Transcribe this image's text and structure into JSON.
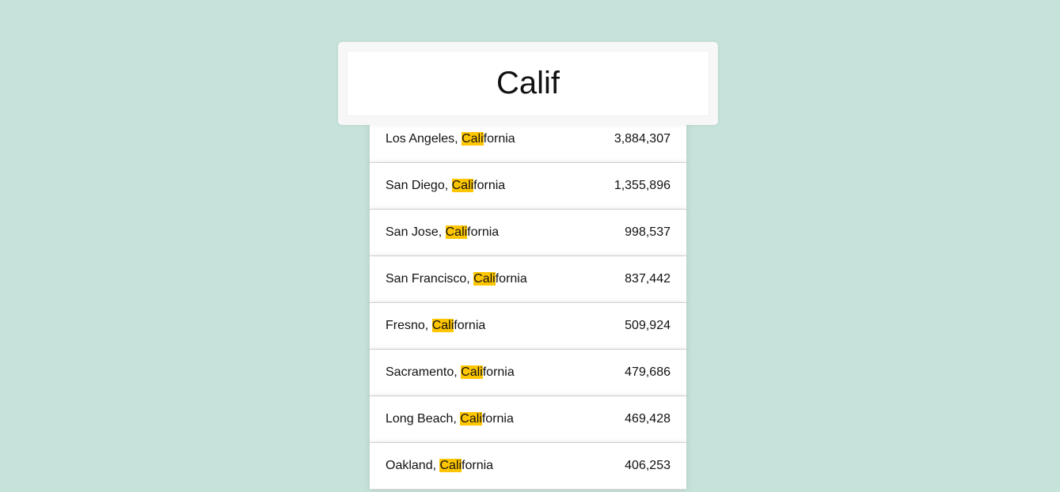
{
  "search": {
    "value": "Calif"
  },
  "highlight_color": "#ffc600",
  "background_color": "#c6e3db",
  "results": [
    {
      "city": "Los Angeles, ",
      "match": "Cali",
      "rest": "fornia",
      "population": "3,884,307"
    },
    {
      "city": "San Diego, ",
      "match": "Cali",
      "rest": "fornia",
      "population": "1,355,896"
    },
    {
      "city": "San Jose, ",
      "match": "Cali",
      "rest": "fornia",
      "population": "998,537"
    },
    {
      "city": "San Francisco, ",
      "match": "Cali",
      "rest": "fornia",
      "population": "837,442"
    },
    {
      "city": "Fresno, ",
      "match": "Cali",
      "rest": "fornia",
      "population": "509,924"
    },
    {
      "city": "Sacramento, ",
      "match": "Cali",
      "rest": "fornia",
      "population": "479,686"
    },
    {
      "city": "Long Beach, ",
      "match": "Cali",
      "rest": "fornia",
      "population": "469,428"
    },
    {
      "city": "Oakland, ",
      "match": "Cali",
      "rest": "fornia",
      "population": "406,253"
    }
  ]
}
